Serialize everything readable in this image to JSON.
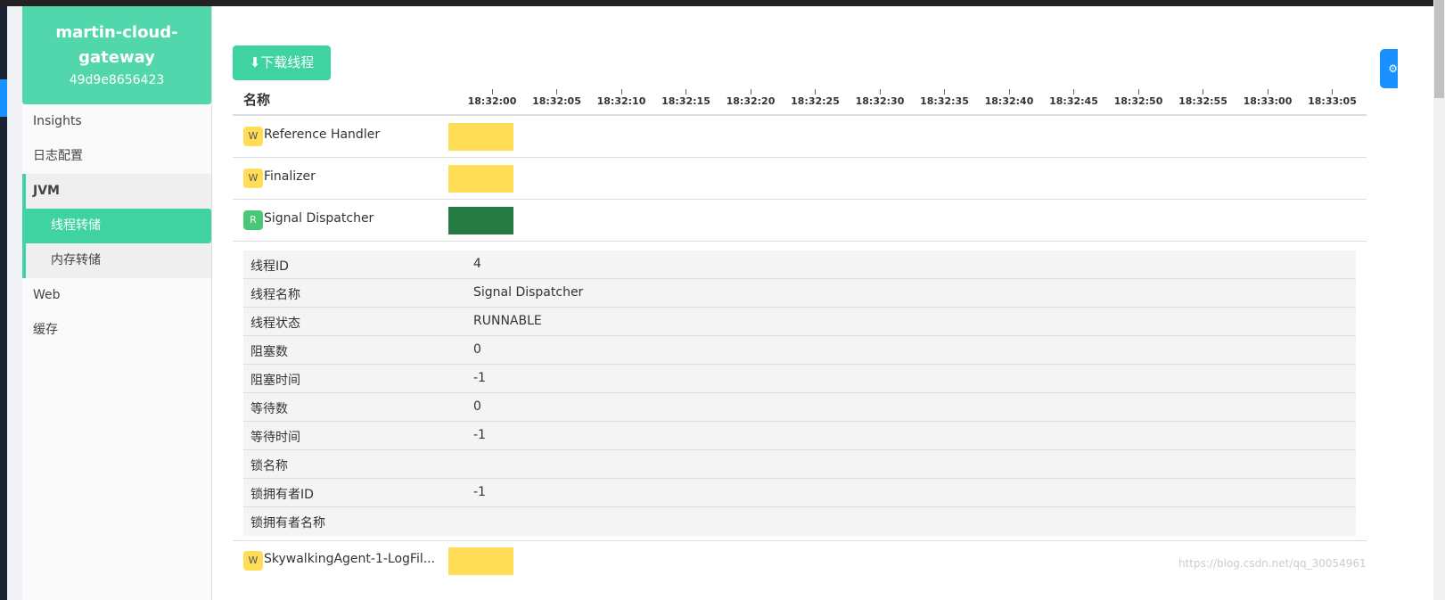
{
  "sidebar": {
    "app_name": "martin-cloud-gateway",
    "instance_id": "49d9e8656423",
    "items": [
      "Insights",
      "日志配置",
      "JVM",
      "线程转储",
      "内存转储",
      "Web",
      "缓存"
    ]
  },
  "main": {
    "download_label": "下载线程",
    "name_header": "名称",
    "ticks": [
      "18:32:00",
      "18:32:05",
      "18:32:10",
      "18:32:15",
      "18:32:20",
      "18:32:25",
      "18:32:30",
      "18:32:35",
      "18:32:40",
      "18:32:45",
      "18:32:50",
      "18:32:55",
      "18:33:00",
      "18:33:05"
    ],
    "threads": [
      {
        "state": "W",
        "name": "Reference Handler",
        "color": "#ffdd57"
      },
      {
        "state": "W",
        "name": "Finalizer",
        "color": "#ffdd57"
      },
      {
        "state": "R",
        "name": "Signal Dispatcher",
        "color": "#257942"
      },
      {
        "state": "W",
        "name": "SkywalkingAgent-1-LogFil...",
        "color": "#ffdd57"
      }
    ],
    "details": [
      {
        "k": "线程ID",
        "v": "4"
      },
      {
        "k": "线程名称",
        "v": "Signal Dispatcher"
      },
      {
        "k": "线程状态",
        "v": "RUNNABLE"
      },
      {
        "k": "阻塞数",
        "v": "0"
      },
      {
        "k": "阻塞时间",
        "v": "-1"
      },
      {
        "k": "等待数",
        "v": "0"
      },
      {
        "k": "等待时间",
        "v": "-1"
      },
      {
        "k": "锁名称",
        "v": ""
      },
      {
        "k": "锁拥有者ID",
        "v": "-1"
      },
      {
        "k": "锁拥有者名称",
        "v": ""
      }
    ]
  },
  "float_tab_icon": "settings-icon",
  "watermark": "https://blog.csdn.net/qq_30054961"
}
